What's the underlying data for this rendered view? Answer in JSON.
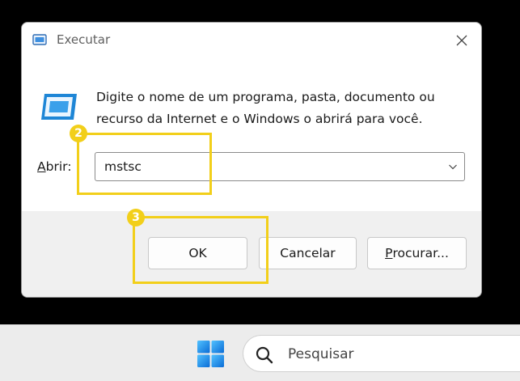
{
  "dialog": {
    "title": "Executar",
    "description": "Digite o nome de um programa, pasta, documento ou recurso da Internet e o Windows o abrirá para você.",
    "open_label_mnemonic": "A",
    "open_label_rest": "brir:",
    "open_value": "mstsc",
    "buttons": {
      "ok": "OK",
      "cancel": "Cancelar",
      "browse_mnemonic": "P",
      "browse_rest": "rocurar..."
    }
  },
  "annotations": {
    "step_2": "2",
    "step_3": "3",
    "highlight_color": "#f2cf1a"
  },
  "taskbar": {
    "search_placeholder": "Pesquisar"
  },
  "colors": {
    "accent": "#1a7fd6",
    "dialog_footer": "#f0f0f0",
    "taskbar": "#ececec"
  },
  "icons": [
    "run-app-icon",
    "close-icon",
    "run-program-icon",
    "chevron-down-icon",
    "windows-logo-icon",
    "search-icon"
  ]
}
